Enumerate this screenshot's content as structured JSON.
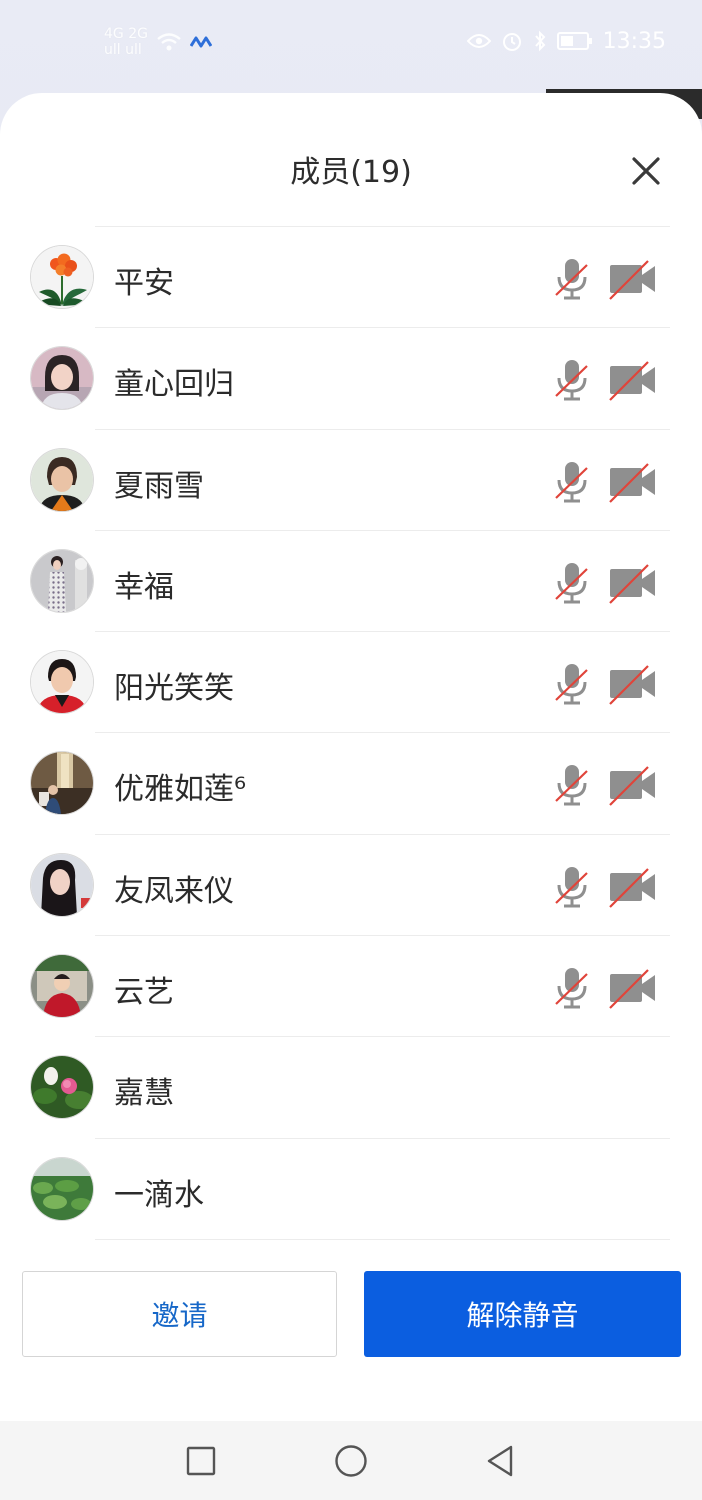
{
  "status_bar": {
    "signal_text_1": "4G 2G",
    "signal_text_2": "ull ull",
    "time": "13:35"
  },
  "sheet": {
    "title": "成员(19)"
  },
  "members": [
    {
      "name": "平安",
      "muted": true,
      "camera_off": true
    },
    {
      "name": "童心回归",
      "muted": true,
      "camera_off": true
    },
    {
      "name": "夏雨雪",
      "muted": true,
      "camera_off": true
    },
    {
      "name": "幸福",
      "muted": true,
      "camera_off": true
    },
    {
      "name": "阳光笑笑",
      "muted": true,
      "camera_off": true
    },
    {
      "name": "优雅如莲⁶",
      "muted": true,
      "camera_off": true
    },
    {
      "name": "友凤来仪",
      "muted": true,
      "camera_off": true
    },
    {
      "name": "云艺",
      "muted": true,
      "camera_off": true
    },
    {
      "name": "嘉慧",
      "muted": false,
      "camera_off": false
    },
    {
      "name": "一滴水",
      "muted": false,
      "camera_off": false
    }
  ],
  "footer": {
    "invite_label": "邀请",
    "unmute_label": "解除静音"
  },
  "colors": {
    "primary_blue": "#0b5ee0",
    "invite_text": "#1667c8",
    "icon_gray": "#8f8f8f",
    "slash_red": "#e0443a"
  },
  "icons": {
    "close": "close-icon",
    "mic_muted": "mic-muted-icon",
    "camera_off": "camera-off-icon",
    "nav_recent": "square-icon",
    "nav_home": "circle-icon",
    "nav_back": "triangle-back-icon"
  }
}
